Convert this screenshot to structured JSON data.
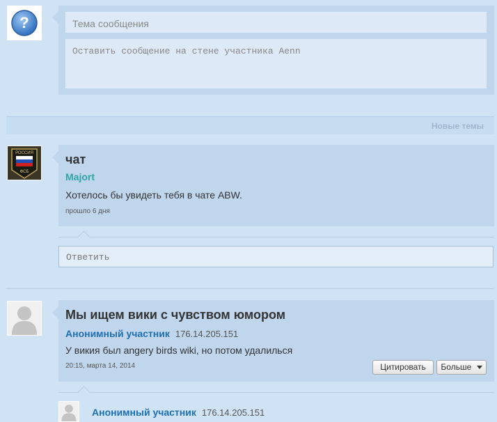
{
  "wall_form": {
    "subject_placeholder": "Тема сообщения",
    "message_placeholder": "Оставить сообщение на стене участника Aenn"
  },
  "section_bar": {
    "new_topics_label": "Новые темы"
  },
  "threads": [
    {
      "title": "чат",
      "author": "Majort",
      "author_color": "#2fa5a5",
      "message": "Хотелось бы увидеть тебя в чате ABW.",
      "time": "прошло 6 дня",
      "reply_placeholder": "Ответить"
    },
    {
      "title": "Мы ищем вики с чувством юмором",
      "author": "Анонимный участник",
      "ip": "176.14.205.151",
      "author_color": "#1e6fb0",
      "message": "У викия был angery birds wiki, но потом удалилься",
      "time": "20:15, марта 14, 2014",
      "quote_label": "Цитировать",
      "more_label": "Больше",
      "reply": {
        "author": "Анонимный участник",
        "ip": "176.14.205.151"
      }
    }
  ]
}
